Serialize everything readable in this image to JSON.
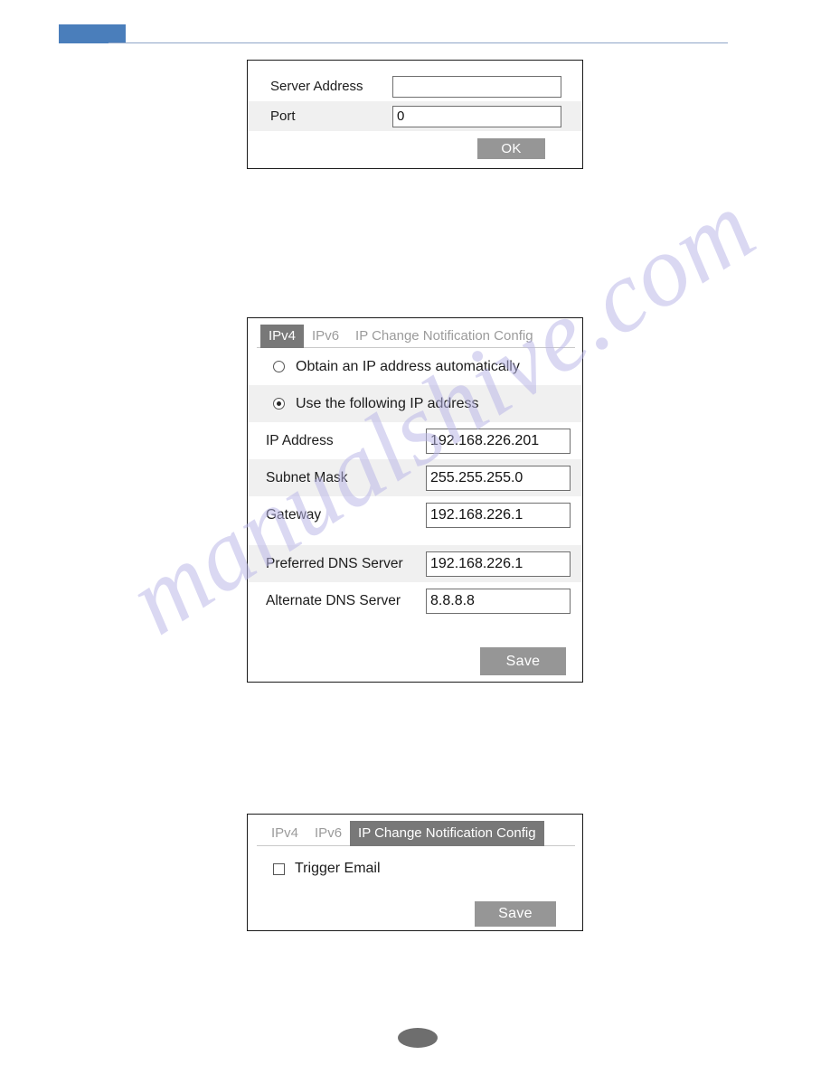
{
  "page": {
    "header_accent_color": "#4a7ebb",
    "watermark_text": "manualshive.com",
    "footer_marker": ""
  },
  "server_panel": {
    "rows": [
      {
        "label": "Server Address",
        "value": ""
      },
      {
        "label": "Port",
        "value": "0"
      }
    ],
    "ok_label": "OK"
  },
  "ipv4_panel": {
    "tabs": [
      {
        "label": "IPv4",
        "active": true
      },
      {
        "label": "IPv6",
        "active": false
      },
      {
        "label": "IP Change Notification Config",
        "active": false
      }
    ],
    "radios": [
      {
        "label": "Obtain an IP address automatically",
        "checked": false
      },
      {
        "label": "Use the following IP address",
        "checked": true
      }
    ],
    "fields": [
      {
        "label": "IP Address",
        "value": "192.168.226.201"
      },
      {
        "label": "Subnet Mask",
        "value": "255.255.255.0"
      },
      {
        "label": "Gateway",
        "value": "192.168.226.1"
      },
      {
        "label": "Preferred DNS Server",
        "value": "192.168.226.1"
      },
      {
        "label": "Alternate DNS Server",
        "value": "8.8.8.8"
      }
    ],
    "save_label": "Save"
  },
  "notify_panel": {
    "tabs": [
      {
        "label": "IPv4",
        "active": false
      },
      {
        "label": "IPv6",
        "active": false
      },
      {
        "label": "IP Change Notification Config",
        "active": true
      }
    ],
    "checkbox": {
      "label": "Trigger Email",
      "checked": false
    },
    "save_label": "Save"
  }
}
